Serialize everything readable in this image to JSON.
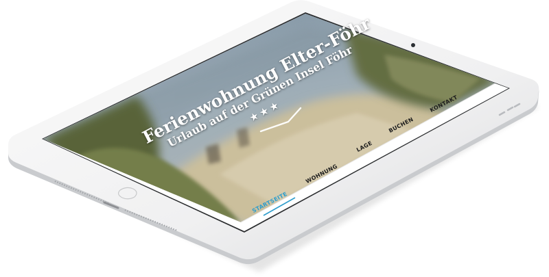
{
  "hero": {
    "title": "Ferienwohnung Elter-Föhr",
    "subtitle": "Urlaub auf der Grünen Insel Föhr",
    "rating_stars": "★★★"
  },
  "nav": {
    "items": [
      {
        "label": "STARTSEITE",
        "active": true
      },
      {
        "label": "WOHNUNG",
        "active": false
      },
      {
        "label": "LAGE",
        "active": false
      },
      {
        "label": "BUCHEN",
        "active": false
      },
      {
        "label": "KONTAKT",
        "active": false
      }
    ]
  },
  "colors": {
    "accent": "#2e9dcc",
    "nav_text": "#1d1d1d",
    "device_frame": "#f4f4f5",
    "sky": "#9fb4c4",
    "sand": "#d7c9a4",
    "grass": "#6e7a48"
  }
}
